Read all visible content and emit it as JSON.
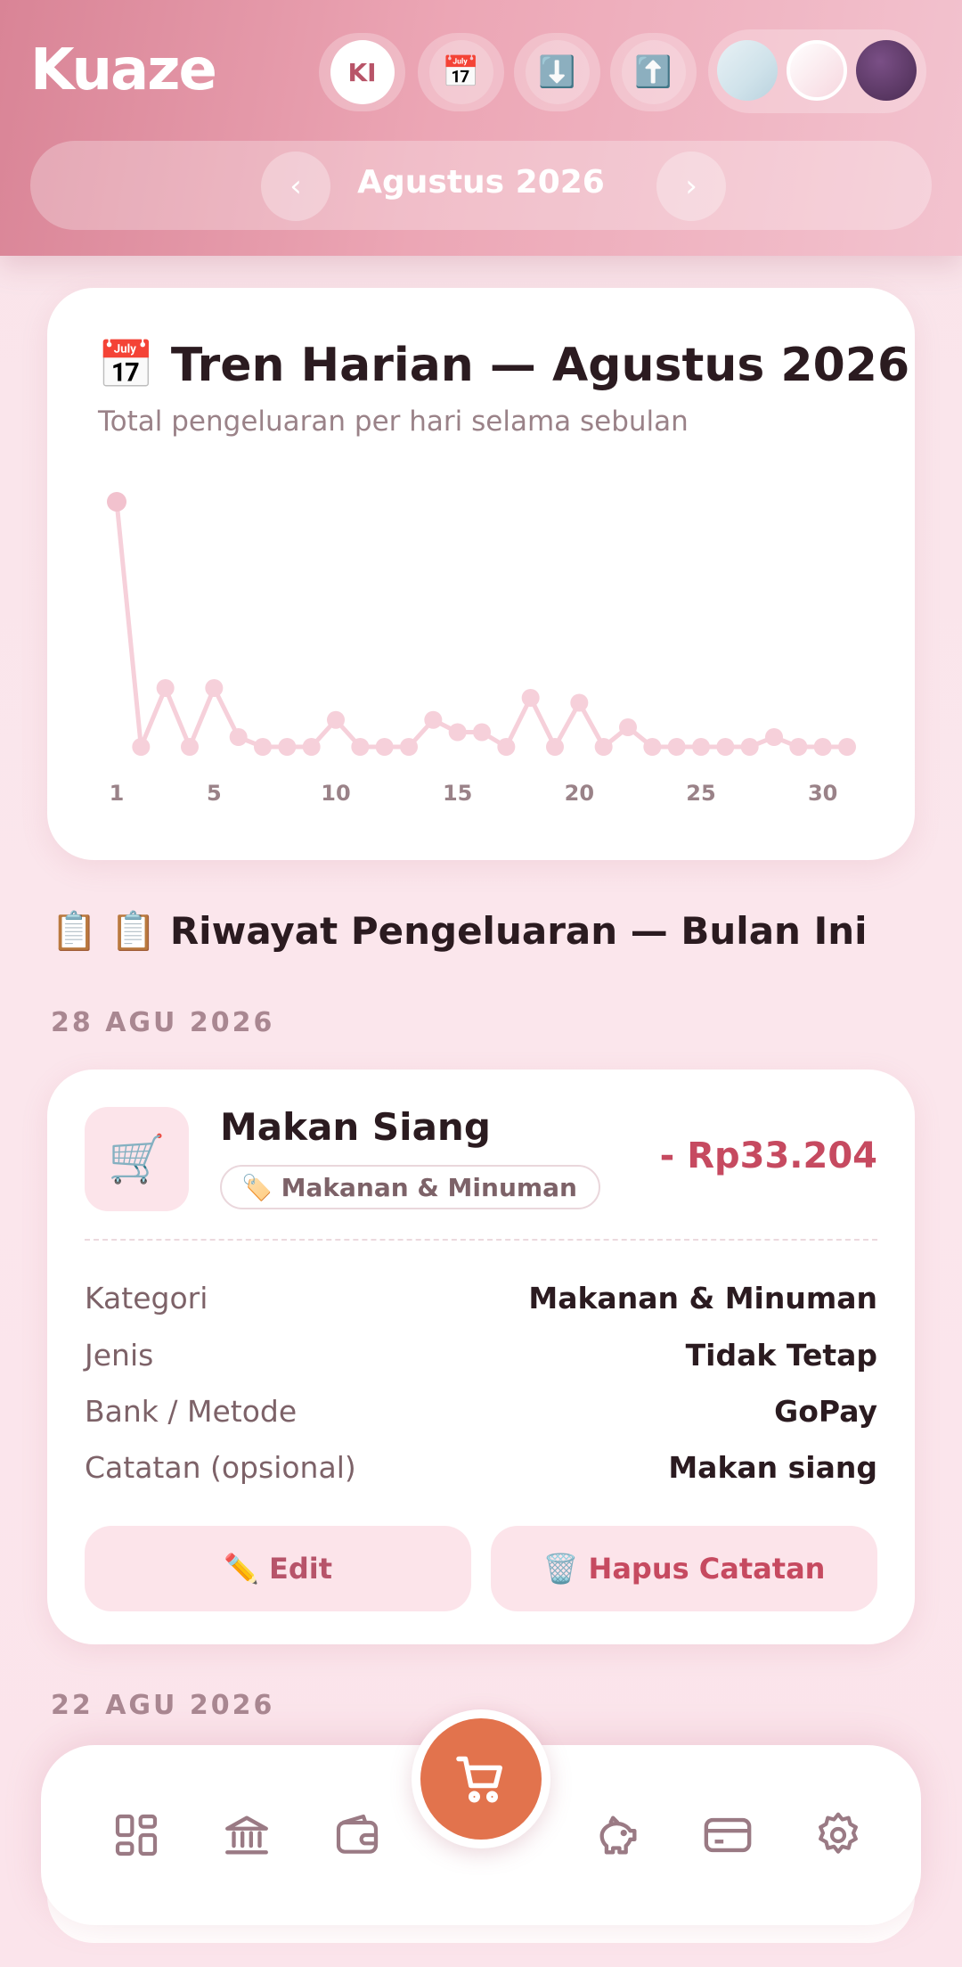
{
  "app": {
    "logo": "Kuaze"
  },
  "header": {
    "avatar_initials": "KI",
    "calendar_icon": "calendar-icon",
    "download_icon": "download-icon",
    "upload_icon": "upload-icon",
    "month_label": "Agustus 2026",
    "prev_label": "‹",
    "next_label": "›",
    "themes": [
      "#cfe2ea",
      "#f7d7df",
      "#4a2c52"
    ]
  },
  "chart": {
    "title": "📅 Tren Harian — Agustus 2026",
    "subtitle": "Total pengeluaran per hari selama sebulan"
  },
  "chart_data": {
    "type": "line",
    "title": "Tren Harian — Agustus 2026",
    "x": [
      1,
      2,
      3,
      4,
      5,
      6,
      7,
      8,
      9,
      10,
      11,
      12,
      13,
      14,
      15,
      16,
      17,
      18,
      19,
      20,
      21,
      22,
      23,
      24,
      25,
      26,
      27,
      28,
      29,
      30,
      31
    ],
    "x_ticks": [
      "1",
      "5",
      "10",
      "15",
      "20",
      "25",
      "30"
    ],
    "series": [
      {
        "values": [
          100,
          0,
          24,
          0,
          24,
          4,
          0,
          0,
          0,
          11,
          0,
          0,
          0,
          11,
          6,
          6,
          0,
          20,
          0,
          18,
          0,
          8,
          0,
          0,
          0,
          0,
          0,
          4,
          0,
          0,
          0
        ]
      }
    ],
    "color": "#f6d0da",
    "grid": false
  },
  "history": {
    "section_title": "📋 📋 Riwayat Pengeluaran — Bulan Ini",
    "groups": [
      {
        "date": "28 AGU 2026",
        "transaction": {
          "icon": "🛒",
          "name": "Makan Siang",
          "tag": "🏷️ Makanan & Minuman",
          "amount": "- Rp33.204",
          "rows": [
            {
              "key": "Kategori",
              "value": "Makanan & Minuman"
            },
            {
              "key": "Jenis",
              "value": "Tidak Tetap"
            },
            {
              "key": "Bank / Metode",
              "value": "GoPay"
            },
            {
              "key": "Catatan (opsional)",
              "value": "Makan siang"
            }
          ],
          "edit_label": "✏️ Edit",
          "delete_label": "🗑️ Hapus Catatan"
        }
      },
      {
        "date": "22 AGU 2026"
      }
    ]
  },
  "bottom_nav": {
    "items": [
      "dashboard-icon",
      "bank-icon",
      "wallet-icon",
      "piggy-bank-icon",
      "card-icon",
      "settings-icon"
    ],
    "fab_icon": "cart-icon"
  }
}
